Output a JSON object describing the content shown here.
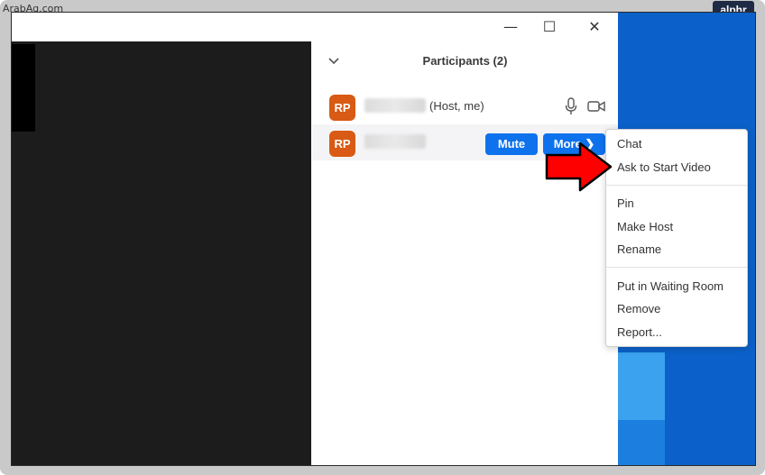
{
  "watermark": "ArabAq.com",
  "brand": "alphr",
  "window": {
    "minimize_glyph": "—",
    "maximize_glyph": "☐",
    "close_glyph": "✕"
  },
  "participants": {
    "title": "Participants (2)",
    "rows": [
      {
        "initials": "RP",
        "suffix": "(Host, me)"
      },
      {
        "initials": "RP",
        "mute_label": "Mute",
        "more_label": "More ❯"
      }
    ]
  },
  "context_menu": {
    "items": [
      "Chat",
      "Ask to Start Video",
      "Pin",
      "Make Host",
      "Rename",
      "Put in Waiting Room",
      "Remove",
      "Report..."
    ]
  },
  "colors": {
    "zoom_blue": "#0e72ed",
    "avatar_orange": "#d85a14",
    "arrow_red": "#ff0000"
  },
  "icons": [
    "chevron-down-icon",
    "microphone-icon",
    "video-camera-icon",
    "red-arrow-icon"
  ]
}
